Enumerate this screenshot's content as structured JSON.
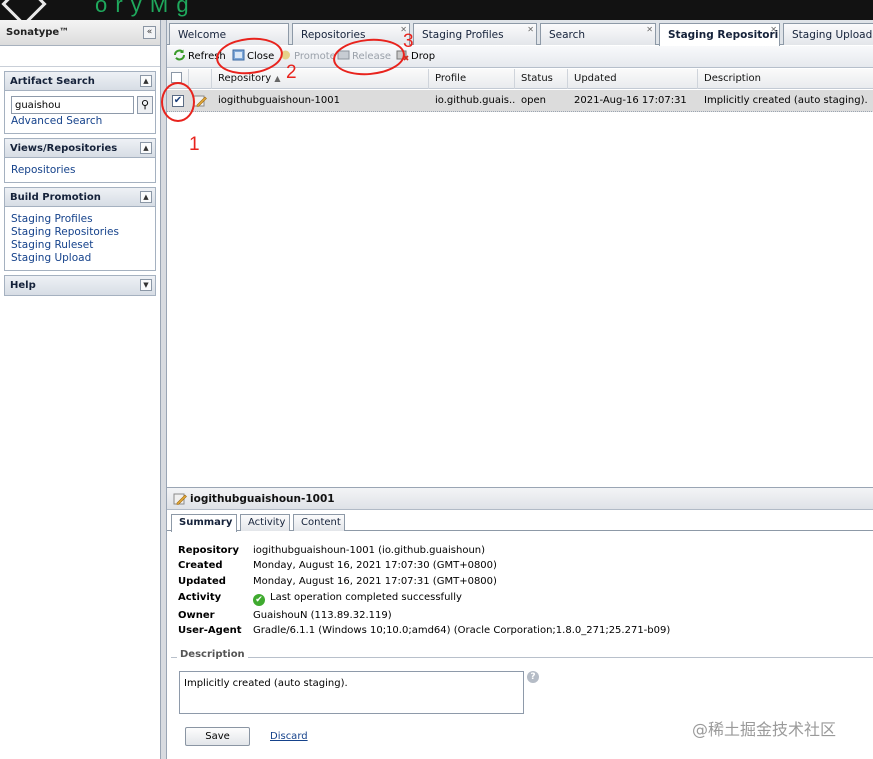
{
  "app": {
    "brand": "Sonatype™",
    "topbar_text": "o r y M g"
  },
  "left_panel": {
    "artifact_search": {
      "title": "Artifact Search",
      "query": "guaishou",
      "advanced_link": "Advanced Search"
    },
    "views": {
      "title": "Views/Repositories",
      "items": [
        "Repositories"
      ]
    },
    "build_promotion": {
      "title": "Build Promotion",
      "items": [
        "Staging Profiles",
        "Staging Repositories",
        "Staging Ruleset",
        "Staging Upload"
      ]
    },
    "help": {
      "title": "Help"
    },
    "collapse_glyph": "«"
  },
  "tabs": [
    "Welcome",
    "Repositories",
    "Staging Profiles",
    "Search",
    "Staging Repositori",
    "Staging Upload"
  ],
  "toolbar": {
    "refresh": "Refresh",
    "close": "Close",
    "promote": "Promote",
    "release": "Release",
    "drop": "Drop"
  },
  "grid": {
    "columns": [
      "Repository",
      "Profile",
      "Status",
      "Updated",
      "Description"
    ],
    "rows": [
      {
        "repository": "iogithubguaishoun-1001",
        "profile": "io.github.guais...",
        "status": "open",
        "updated": "2021-Aug-16 17:07:31",
        "description": "Implicitly created (auto staging)."
      }
    ]
  },
  "annotations": [
    "1",
    "2",
    "3"
  ],
  "detail": {
    "title": "iogithubguaishoun-1001",
    "tabs": [
      "Summary",
      "Activity",
      "Content"
    ],
    "fields": [
      {
        "key": "Repository",
        "value": "iogithubguaishoun-1001 (io.github.guaishoun)"
      },
      {
        "key": "Created",
        "value": "Monday, August 16, 2021 17:07:30 (GMT+0800)"
      },
      {
        "key": "Updated",
        "value": "Monday, August 16, 2021 17:07:31 (GMT+0800)"
      },
      {
        "key": "Activity",
        "value": "Last operation completed successfully"
      },
      {
        "key": "Owner",
        "value": "GuaishouN (113.89.32.119)"
      },
      {
        "key": "User-Agent",
        "value": "Gradle/6.1.1 (Windows 10;10.0;amd64) (Oracle Corporation;1.8.0_271;25.271-b09)"
      }
    ],
    "description_legend": "Description",
    "description_value": "Implicitly created (auto staging).",
    "save_label": "Save",
    "discard_label": "Discard"
  },
  "watermark": "@稀土掘金技术社区",
  "colors": {
    "accent_red": "#e8231d",
    "link_blue": "#15428b",
    "brand_green": "#1fa85c"
  }
}
